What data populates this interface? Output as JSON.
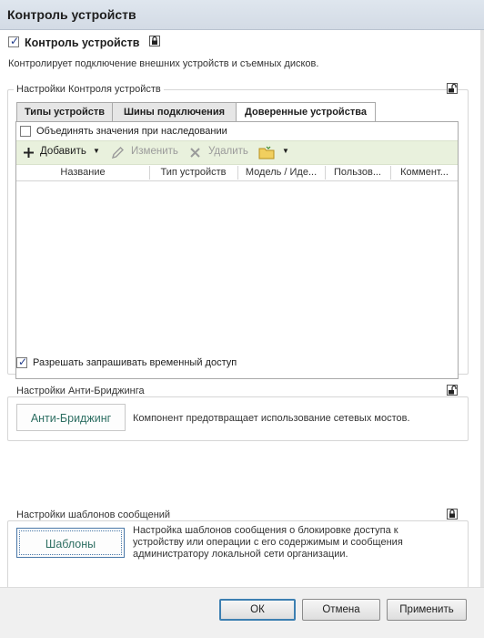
{
  "window": {
    "title": "Контроль устройств"
  },
  "header": {
    "checkbox_label": "Контроль устройств",
    "checked": true,
    "description": "Контролирует подключение внешних устройств и съемных дисков."
  },
  "device_settings": {
    "group_label": "Настройки Контроля устройств",
    "tabs": [
      {
        "label": "Типы устройств",
        "active": false
      },
      {
        "label": "Шины подключения",
        "active": false
      },
      {
        "label": "Доверенные устройства",
        "active": true
      }
    ],
    "merge_label": "Объединять значения при наследовании",
    "merge_checked": false,
    "toolbar": {
      "add": "Добавить",
      "edit": "Изменить",
      "delete": "Удалить"
    },
    "columns": [
      "Название",
      "Тип устройств",
      "Модель / Иде...",
      "Пользов...",
      "Коммент..."
    ],
    "temp_access_label": "Разрешать запрашивать временный доступ",
    "temp_access_checked": true
  },
  "anti_bridging": {
    "group_label": "Настройки Анти-Бриджинга",
    "button": "Анти-Бриджинг",
    "description": "Компонент предотвращает использование сетевых мостов."
  },
  "templates": {
    "group_label": "Настройки шаблонов сообщений",
    "button": "Шаблоны",
    "description_lines": [
      "Настройка шаблонов сообщения о блокировке доступа к",
      "устройству или операции с его содержимым и сообщения",
      "администратору локальной сети организации."
    ]
  },
  "dialog_buttons": {
    "ok": "ОК",
    "cancel": "Отмена",
    "apply": "Применить"
  },
  "colors": {
    "accent_text": "#2e6f63",
    "toolbar_bg": "#e9f1dd",
    "default_border": "#3c7fb1"
  }
}
